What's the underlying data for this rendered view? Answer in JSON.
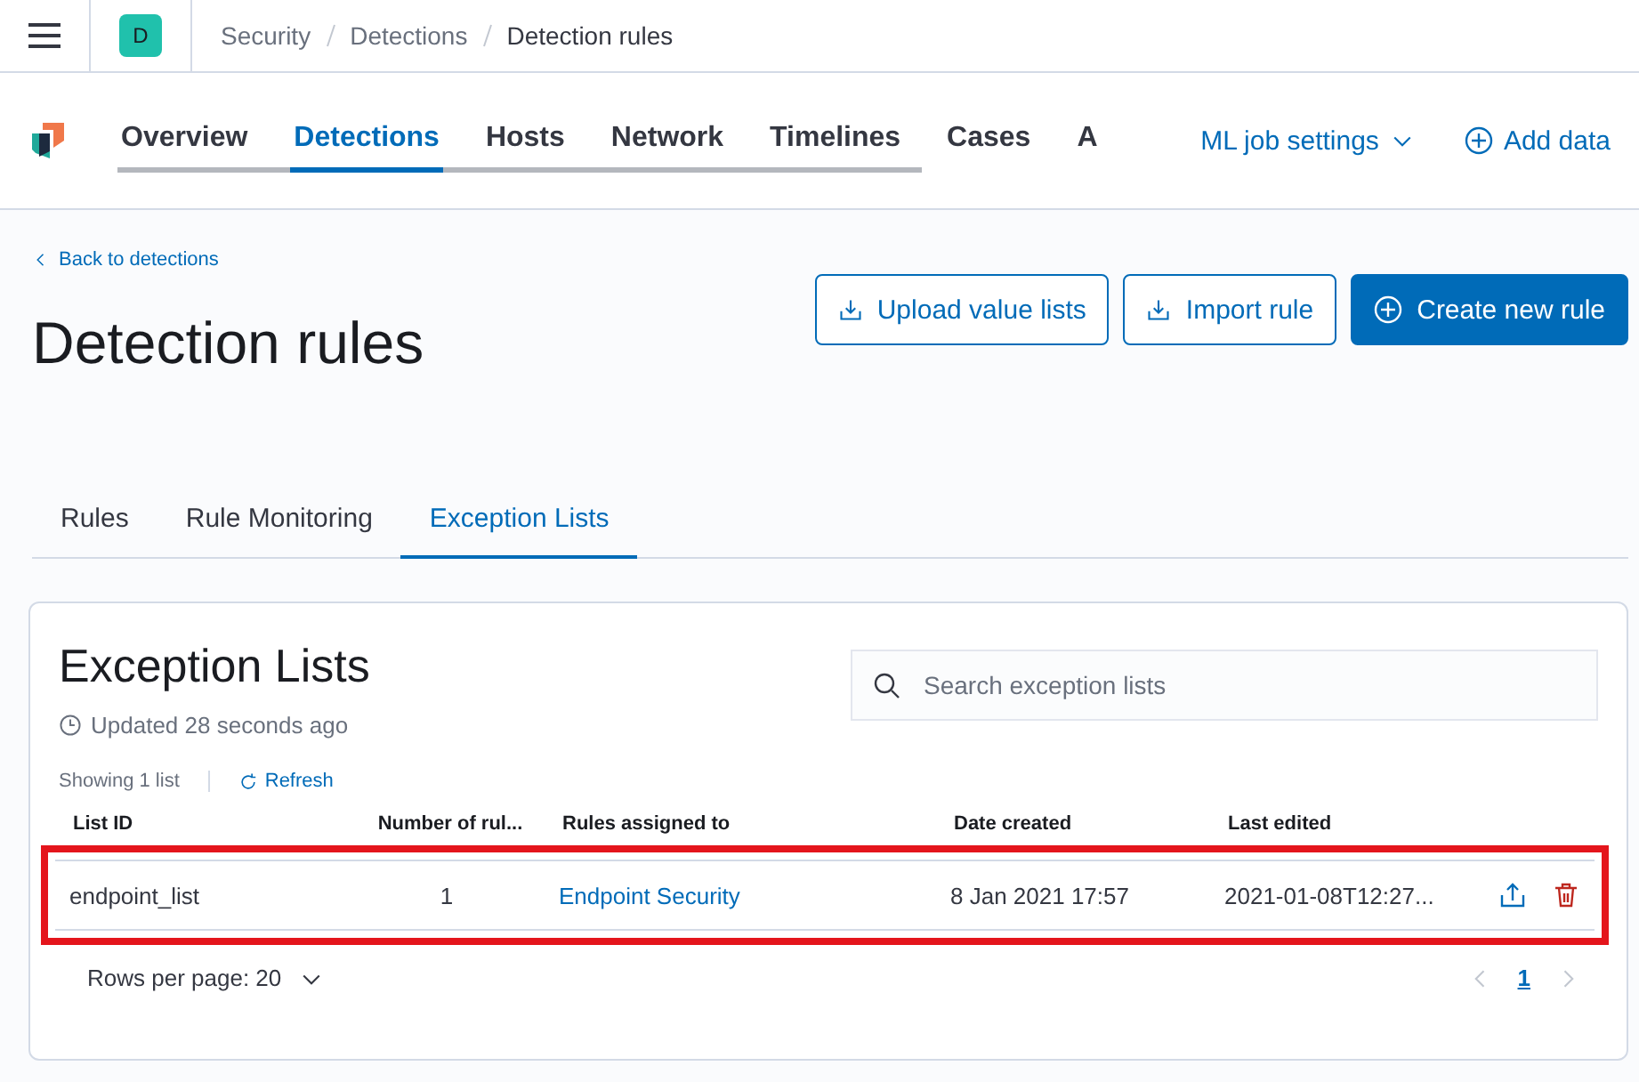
{
  "header": {
    "avatar": "D",
    "breadcrumbs": [
      {
        "label": "Security",
        "current": false
      },
      {
        "label": "Detections",
        "current": false
      },
      {
        "label": "Detection rules",
        "current": true
      }
    ]
  },
  "nav": {
    "tabs": [
      {
        "label": "Overview",
        "selected": false
      },
      {
        "label": "Detections",
        "selected": true
      },
      {
        "label": "Hosts",
        "selected": false
      },
      {
        "label": "Network",
        "selected": false
      },
      {
        "label": "Timelines",
        "selected": false
      },
      {
        "label": "Cases",
        "selected": false
      },
      {
        "label": "A",
        "selected": false
      }
    ],
    "ml_settings": "ML job settings",
    "add_data": "Add data"
  },
  "page": {
    "back_link": "Back to detections",
    "title": "Detection rules",
    "buttons": [
      {
        "label": "Upload value lists",
        "kind": "outline"
      },
      {
        "label": "Import rule",
        "kind": "outline"
      },
      {
        "label": "Create new rule",
        "kind": "primary"
      }
    ],
    "tabs": [
      {
        "label": "Rules",
        "selected": false
      },
      {
        "label": "Rule Monitoring",
        "selected": false
      },
      {
        "label": "Exception Lists",
        "selected": true
      }
    ]
  },
  "panel": {
    "title": "Exception Lists",
    "updated": "Updated 28 seconds ago",
    "search": {
      "placeholder": "Search exception lists"
    },
    "showing": "Showing 1 list",
    "refresh": "Refresh",
    "table": {
      "columns": [
        "List ID",
        "Number of rul...",
        "Rules assigned to",
        "Date created",
        "Last edited"
      ],
      "rows": [
        {
          "list_id": "endpoint_list",
          "count": "1",
          "rules": "Endpoint Security",
          "created": "8 Jan 2021 17:57",
          "edited": "2021-01-08T12:27...",
          "highlighted": true
        }
      ]
    },
    "rows_per_page": "Rows per page: 20",
    "pages": [
      {
        "label": "1",
        "selected": true
      }
    ]
  }
}
